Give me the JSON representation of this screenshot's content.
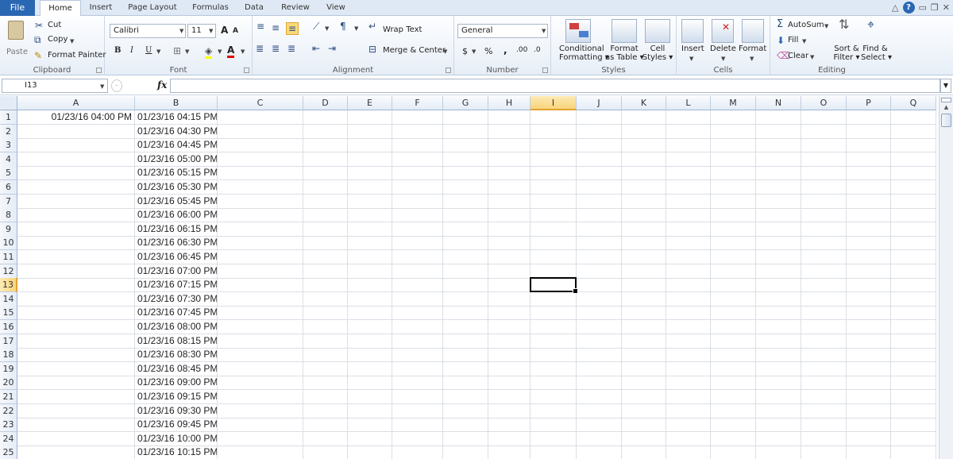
{
  "tabs": {
    "file": "File",
    "items": [
      "Home",
      "Insert",
      "Page Layout",
      "Formulas",
      "Data",
      "Review",
      "View"
    ],
    "active": "Home"
  },
  "ribbon": {
    "clipboard": {
      "label": "Clipboard",
      "paste": "Paste",
      "cut": "Cut",
      "copy": "Copy",
      "format_painter": "Format Painter"
    },
    "font": {
      "label": "Font",
      "name": "Calibri",
      "size": "11",
      "bold": "B",
      "italic": "I",
      "underline": "U",
      "grow": "A",
      "shrink": "A"
    },
    "alignment": {
      "label": "Alignment",
      "wrap_text": "Wrap Text",
      "merge_center": "Merge & Center"
    },
    "number": {
      "label": "Number",
      "format": "General",
      "currency": "$",
      "percent": "%",
      "comma": ",",
      "inc_decimal": ".00",
      "dec_decimal": ".0"
    },
    "styles": {
      "label": "Styles",
      "conditional_1": "Conditional",
      "conditional_2": "Formatting",
      "format_table_1": "Format",
      "format_table_2": "as Table",
      "cell_styles_1": "Cell",
      "cell_styles_2": "Styles"
    },
    "cells": {
      "label": "Cells",
      "insert": "Insert",
      "delete": "Delete",
      "format": "Format"
    },
    "editing": {
      "label": "Editing",
      "autosum": "AutoSum",
      "fill": "Fill",
      "clear": "Clear",
      "sort_1": "Sort &",
      "sort_2": "Filter",
      "find_1": "Find &",
      "find_2": "Select"
    }
  },
  "formula_bar": {
    "name_box": "I13",
    "fx": "fx",
    "value": ""
  },
  "sheet": {
    "columns": [
      "A",
      "B",
      "C",
      "D",
      "E",
      "F",
      "G",
      "H",
      "I",
      "J",
      "K",
      "L",
      "M",
      "N",
      "O",
      "P",
      "Q"
    ],
    "selected_column": "I",
    "selected_row": 13,
    "rows": [
      {
        "n": "1",
        "a": "01/23/16 04:00 PM",
        "b": "01/23/16 04:15 PM"
      },
      {
        "n": "2",
        "a": "",
        "b": "01/23/16 04:30 PM"
      },
      {
        "n": "3",
        "a": "",
        "b": "01/23/16 04:45 PM"
      },
      {
        "n": "4",
        "a": "",
        "b": "01/23/16 05:00 PM"
      },
      {
        "n": "5",
        "a": "",
        "b": "01/23/16 05:15 PM"
      },
      {
        "n": "6",
        "a": "",
        "b": "01/23/16 05:30 PM"
      },
      {
        "n": "7",
        "a": "",
        "b": "01/23/16 05:45 PM"
      },
      {
        "n": "8",
        "a": "",
        "b": "01/23/16 06:00 PM"
      },
      {
        "n": "9",
        "a": "",
        "b": "01/23/16 06:15 PM"
      },
      {
        "n": "10",
        "a": "",
        "b": "01/23/16 06:30 PM"
      },
      {
        "n": "11",
        "a": "",
        "b": "01/23/16 06:45 PM"
      },
      {
        "n": "12",
        "a": "",
        "b": "01/23/16 07:00 PM"
      },
      {
        "n": "13",
        "a": "",
        "b": "01/23/16 07:15 PM"
      },
      {
        "n": "14",
        "a": "",
        "b": "01/23/16 07:30 PM"
      },
      {
        "n": "15",
        "a": "",
        "b": "01/23/16 07:45 PM"
      },
      {
        "n": "16",
        "a": "",
        "b": "01/23/16 08:00 PM"
      },
      {
        "n": "17",
        "a": "",
        "b": "01/23/16 08:15 PM"
      },
      {
        "n": "18",
        "a": "",
        "b": "01/23/16 08:30 PM"
      },
      {
        "n": "19",
        "a": "",
        "b": "01/23/16 08:45 PM"
      },
      {
        "n": "20",
        "a": "",
        "b": "01/23/16 09:00 PM"
      },
      {
        "n": "21",
        "a": "",
        "b": "01/23/16 09:15 PM"
      },
      {
        "n": "22",
        "a": "",
        "b": "01/23/16 09:30 PM"
      },
      {
        "n": "23",
        "a": "",
        "b": "01/23/16 09:45 PM"
      },
      {
        "n": "24",
        "a": "",
        "b": "01/23/16 10:00 PM"
      },
      {
        "n": "25",
        "a": "",
        "b": "01/23/16 10:15 PM"
      }
    ]
  }
}
